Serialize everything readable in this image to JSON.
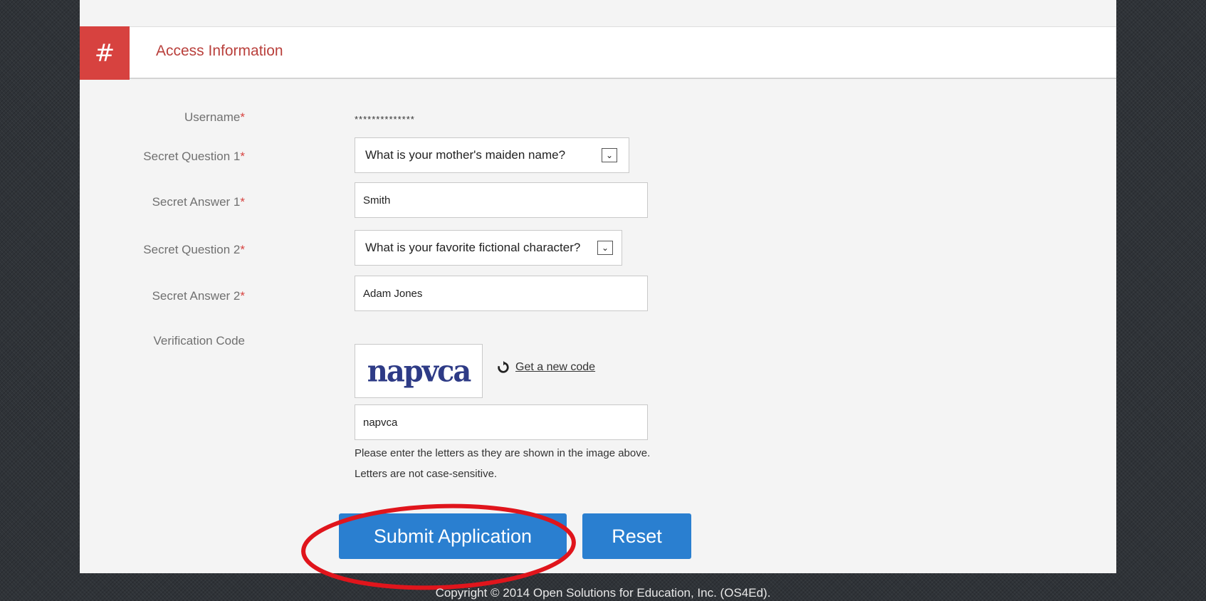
{
  "section": {
    "icon": "hash-icon",
    "hash": "#",
    "title": "Access Information"
  },
  "form": {
    "username": {
      "label": "Username",
      "required": "*",
      "value": "**************"
    },
    "question1": {
      "label": "Secret Question 1",
      "required": "*",
      "value": "What is your mother's maiden name?"
    },
    "answer1": {
      "label": "Secret Answer 1",
      "required": "*",
      "value": "Smith"
    },
    "question2": {
      "label": "Secret Question 2",
      "required": "*",
      "value": "What is your favorite fictional character?"
    },
    "answer2": {
      "label": "Secret Answer 2",
      "required": "*",
      "value": "Adam Jones"
    },
    "verification": {
      "label": "Verification Code",
      "captcha_text": "napvca",
      "new_code_link": "Get a new code",
      "value": "napvca",
      "help_line1": "Please enter the letters as they are shown in the image above.",
      "help_line2": "Letters are not case-sensitive."
    }
  },
  "buttons": {
    "submit": "Submit Application",
    "reset": "Reset"
  },
  "footer": {
    "copyright": "Copyright © 2014 Open Solutions for Education, Inc. (OS4Ed)."
  },
  "colors": {
    "accent_red": "#d7423f",
    "button_blue": "#2a7fd0",
    "highlight_red": "#e0151c"
  },
  "icons": [
    "hash-icon",
    "chevron-down-icon",
    "refresh-icon"
  ]
}
